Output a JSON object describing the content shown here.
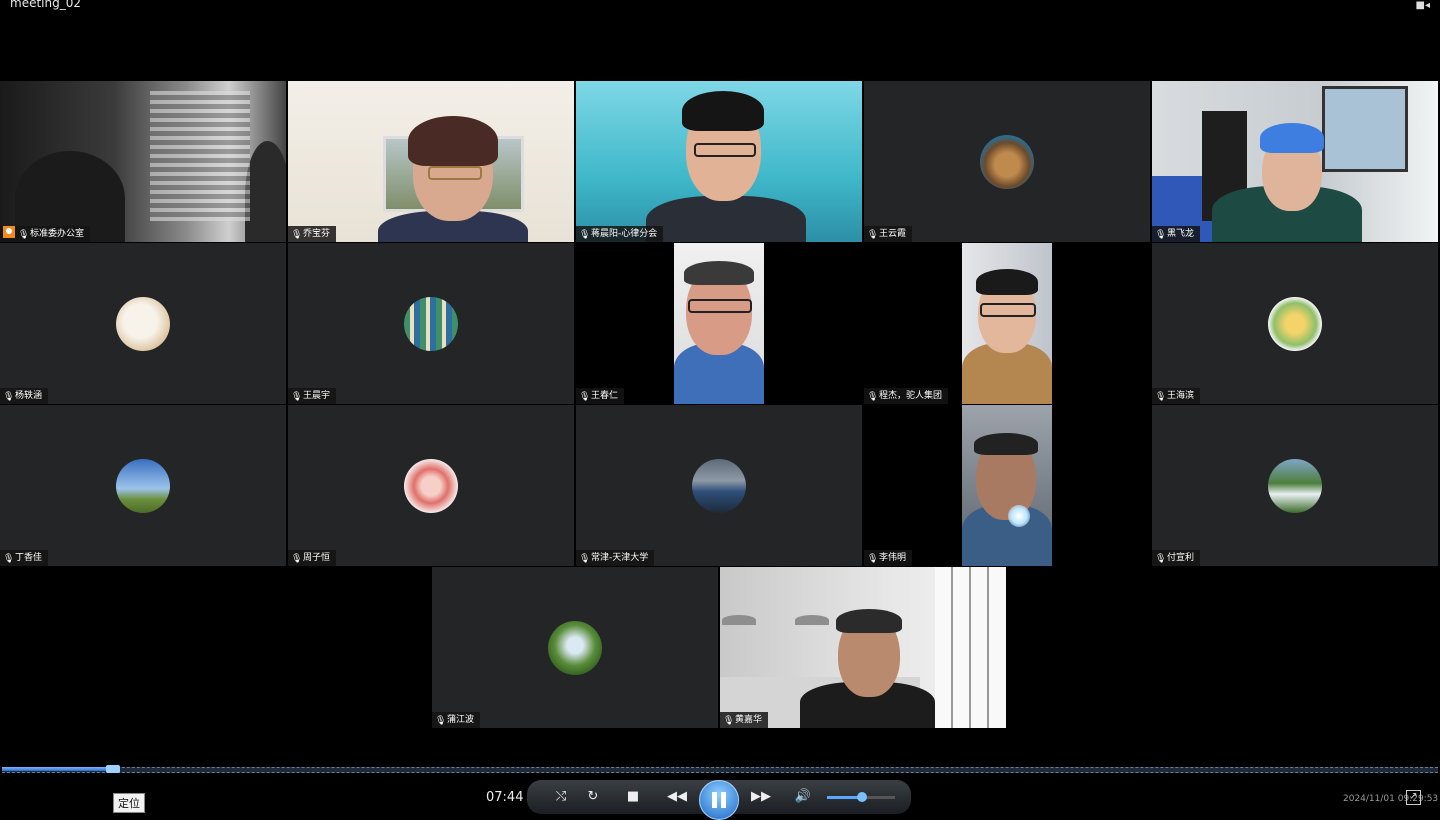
{
  "window": {
    "title": "meeting_02",
    "top_right_icon": "window-controls-icon"
  },
  "participants": [
    {
      "name": "标准委办公室",
      "kind": "video",
      "host": true
    },
    {
      "name": "乔宝芬",
      "kind": "video"
    },
    {
      "name": "蒋晨阳-心律分会",
      "kind": "video"
    },
    {
      "name": "王云霞",
      "kind": "avatar"
    },
    {
      "name": "黑飞龙",
      "kind": "video"
    },
    {
      "name": "杨轶涵",
      "kind": "avatar"
    },
    {
      "name": "王晨宇",
      "kind": "avatar"
    },
    {
      "name": "王春仁",
      "kind": "video"
    },
    {
      "name": "程杰，驼人集团",
      "kind": "video"
    },
    {
      "name": "王海滨",
      "kind": "avatar"
    },
    {
      "name": "丁香佳",
      "kind": "avatar"
    },
    {
      "name": "周子恒",
      "kind": "avatar"
    },
    {
      "name": "常津-天津大学",
      "kind": "avatar"
    },
    {
      "name": "李伟明",
      "kind": "video"
    },
    {
      "name": "付宣利",
      "kind": "avatar"
    },
    {
      "name": "蒲江波",
      "kind": "avatar"
    },
    {
      "name": "黄嘉华",
      "kind": "video"
    }
  ],
  "player": {
    "time": "07:44",
    "tooltip": "定位",
    "timestamp": "2024/11/01 09:29:53",
    "progress_fraction": 0.08,
    "volume_fraction": 0.5,
    "accent": "#2a6fd0"
  }
}
